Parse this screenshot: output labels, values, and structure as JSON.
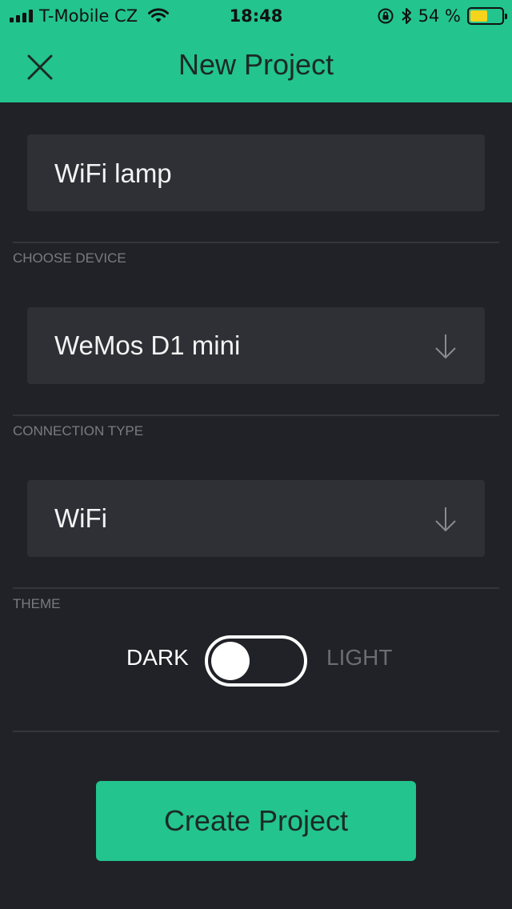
{
  "status_bar": {
    "carrier": "T-Mobile CZ",
    "time": "18:48",
    "battery_percent": "54 %",
    "battery_level": 0.54
  },
  "header": {
    "title": "New Project",
    "close_icon": "close-icon"
  },
  "project_name": {
    "value": "WiFi lamp"
  },
  "device": {
    "label": "CHOOSE DEVICE",
    "selected": "WeMos D1 mini",
    "icon": "arrow-down-icon"
  },
  "connection": {
    "label": "CONNECTION TYPE",
    "selected": "WiFi",
    "icon": "arrow-down-icon"
  },
  "theme": {
    "label": "THEME",
    "dark_label": "DARK",
    "light_label": "LIGHT",
    "selected": "DARK"
  },
  "actions": {
    "create_label": "Create Project"
  },
  "colors": {
    "accent": "#23c48e",
    "background": "#212227",
    "field": "#2f3036",
    "battery": "#f7d41c"
  }
}
